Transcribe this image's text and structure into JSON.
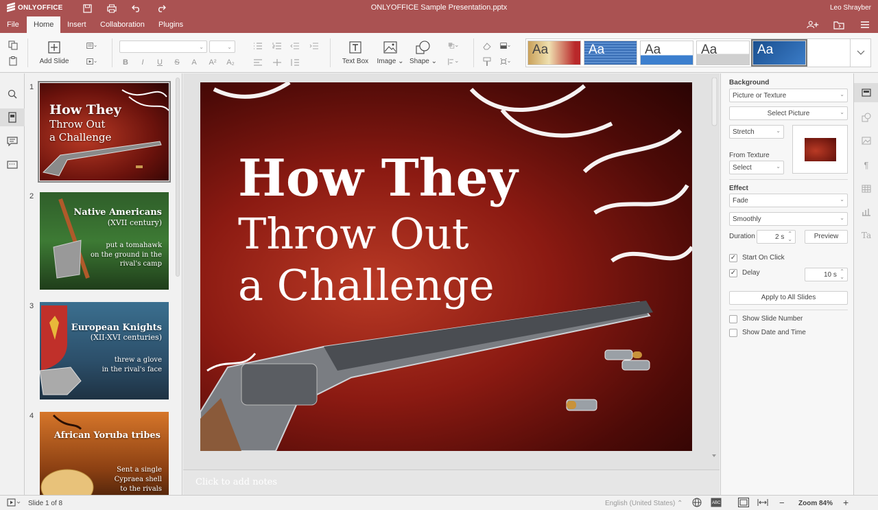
{
  "app": {
    "brand": "ONLYOFFICE",
    "document_title": "ONLYOFFICE Sample Presentation.pptx",
    "user_name": "Leo Shrayber"
  },
  "menu_tabs": [
    {
      "label": "File"
    },
    {
      "label": "Home"
    },
    {
      "label": "Insert"
    },
    {
      "label": "Collaboration"
    },
    {
      "label": "Plugins"
    }
  ],
  "toolbar": {
    "add_slide": "Add Slide",
    "text_box": "Text Box",
    "image": "Image",
    "shape": "Shape",
    "theme_sample": "Aa"
  },
  "slides": [
    {
      "number": "1",
      "title": "How They",
      "line2": "Throw Out",
      "line3": "a Challenge"
    },
    {
      "number": "2",
      "title": "Native Americans",
      "subtitle": "(XVII century)",
      "body1": "put a tomahawk",
      "body2": "on the ground in the",
      "body3": "rival's camp"
    },
    {
      "number": "3",
      "title": "European Knights",
      "subtitle": "(XII-XVI centuries)",
      "body1": "threw a glove",
      "body2": "in the rival's face"
    },
    {
      "number": "4",
      "title": "African Yoruba tribes",
      "body1": "Sent a single",
      "body2": "Cypraea shell",
      "body3": "to the rivals"
    }
  ],
  "current_slide": {
    "line1": "How They",
    "line2": "Throw Out",
    "line3": "a Challenge"
  },
  "notes_placeholder": "Click to add notes",
  "right_panel": {
    "background_label": "Background",
    "background_fill": "Picture or Texture",
    "select_picture": "Select Picture",
    "stretch": "Stretch",
    "from_texture_label": "From Texture",
    "texture_select": "Select",
    "effect_label": "Effect",
    "effect_value": "Fade",
    "effect_type": "Smoothly",
    "duration_label": "Duration",
    "duration_value": "2 s",
    "preview_button": "Preview",
    "start_on_click": "Start On Click",
    "delay_label": "Delay",
    "delay_value": "10 s",
    "apply_all": "Apply to All Slides",
    "show_slide_number": "Show Slide Number",
    "show_date_time": "Show Date and Time"
  },
  "statusbar": {
    "slide_counter": "Slide 1 of 8",
    "language": "English (United States)",
    "zoom": "Zoom 84%"
  },
  "colors": {
    "header": "#aa5252",
    "slide_red": "#8b1a12"
  }
}
